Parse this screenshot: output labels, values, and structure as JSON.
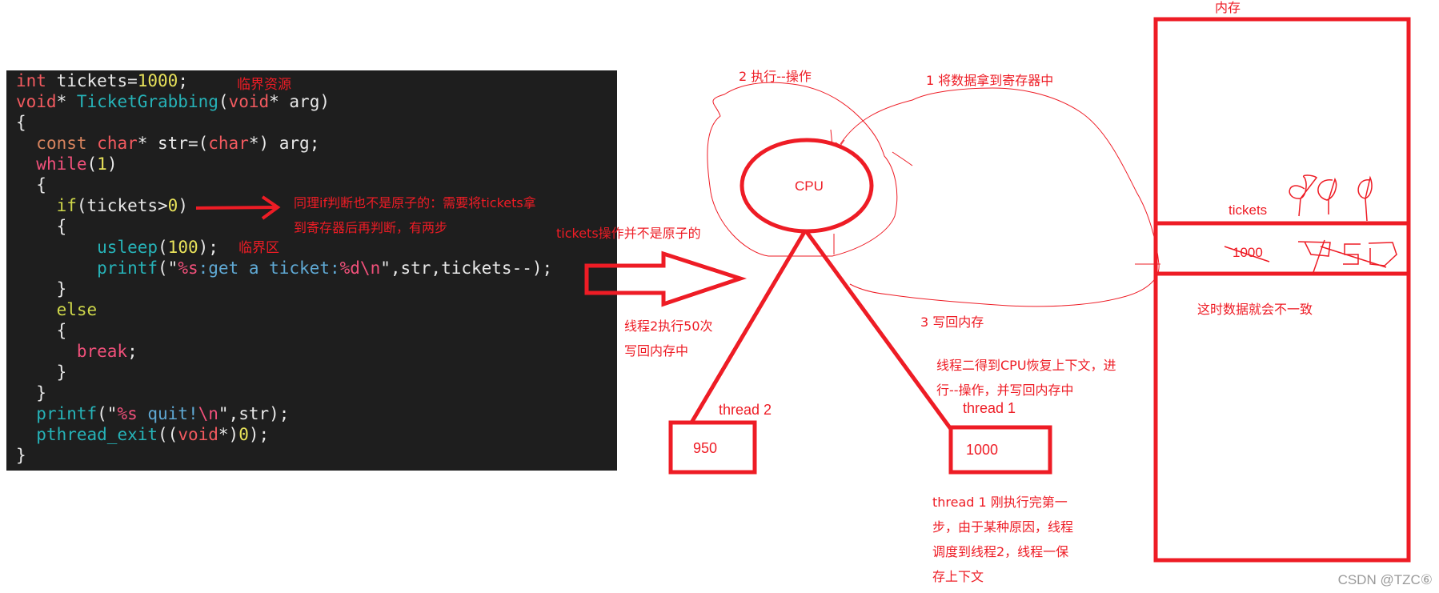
{
  "code": {
    "lines": [
      [
        {
          "t": "int",
          "c": "kw-type"
        },
        {
          "t": " tickets="
        },
        {
          "t": "1000",
          "c": "num"
        },
        {
          "t": ";"
        }
      ],
      [
        {
          "t": "void",
          "c": "kw-type"
        },
        {
          "t": "* "
        },
        {
          "t": "TicketGrabbing",
          "c": "fn"
        },
        {
          "t": "("
        },
        {
          "t": "void",
          "c": "kw-type"
        },
        {
          "t": "* arg)"
        }
      ],
      [
        {
          "t": "{"
        }
      ],
      [
        {
          "t": "  "
        },
        {
          "t": "const",
          "c": "kw-const"
        },
        {
          "t": " "
        },
        {
          "t": "char",
          "c": "kw-type"
        },
        {
          "t": "* str=("
        },
        {
          "t": "char",
          "c": "kw-type"
        },
        {
          "t": "*) arg;"
        }
      ],
      [
        {
          "t": "  "
        },
        {
          "t": "while",
          "c": "kw-ctrl"
        },
        {
          "t": "("
        },
        {
          "t": "1",
          "c": "num"
        },
        {
          "t": ")"
        }
      ],
      [
        {
          "t": "  {"
        }
      ],
      [
        {
          "t": "    "
        },
        {
          "t": "if",
          "c": "kw-if"
        },
        {
          "t": "(tickets>"
        },
        {
          "t": "0",
          "c": "num"
        },
        {
          "t": ")"
        }
      ],
      [
        {
          "t": "    {"
        }
      ],
      [
        {
          "t": "        "
        },
        {
          "t": "usleep",
          "c": "fn"
        },
        {
          "t": "("
        },
        {
          "t": "100",
          "c": "num"
        },
        {
          "t": ");"
        }
      ],
      [
        {
          "t": "        "
        },
        {
          "t": "printf",
          "c": "fn"
        },
        {
          "t": "(\""
        },
        {
          "t": "%s",
          "c": "fmt"
        },
        {
          "t": ":get a ticket:",
          "c": "str"
        },
        {
          "t": "%d",
          "c": "fmt"
        },
        {
          "t": "\\n",
          "c": "esc"
        },
        {
          "t": "\",str,tickets--);"
        }
      ],
      [
        {
          "t": "    }"
        }
      ],
      [
        {
          "t": "    "
        },
        {
          "t": "else",
          "c": "kw-if"
        }
      ],
      [
        {
          "t": "    {"
        }
      ],
      [
        {
          "t": "      "
        },
        {
          "t": "break",
          "c": "kw-ctrl"
        },
        {
          "t": ";"
        }
      ],
      [
        {
          "t": "    }"
        }
      ],
      [
        {
          "t": "  }"
        }
      ],
      [
        {
          "t": "  "
        },
        {
          "t": "printf",
          "c": "fn"
        },
        {
          "t": "(\""
        },
        {
          "t": "%s",
          "c": "fmt"
        },
        {
          "t": " quit!",
          "c": "str"
        },
        {
          "t": "\\n",
          "c": "esc"
        },
        {
          "t": "\",str);"
        }
      ],
      [
        {
          "t": "  "
        },
        {
          "t": "pthread_exit",
          "c": "fn"
        },
        {
          "t": "(("
        },
        {
          "t": "void",
          "c": "kw-type"
        },
        {
          "t": "*)"
        },
        {
          "t": "0",
          "c": "num"
        },
        {
          "t": ");"
        }
      ],
      [
        {
          "t": "}"
        }
      ]
    ]
  },
  "annotations": {
    "critical_resource": "临界资源",
    "critical_section": "临界区",
    "if_not_atomic": "同理if判断也不是原子的：需要将tickets拿\n到寄存器后再判断，有两步",
    "tickets_not_atomic": "tickets操作并不是原子的",
    "step2": "2 执行--操作",
    "step1": "1 将数据拿到寄存器中",
    "step3": "3 写回内存",
    "thread2_exec": "线程2执行50次\n写回内存中",
    "thread2_resume": "线程二得到CPU恢复上下文，进\n行--操作，并写回内存中",
    "thread1_explain": "thread 1 刚执行完第一\n步，由于某种原因，线程\n调度到线程2，线程一保\n存上下文",
    "inconsistent": "这时数据就会不一致"
  },
  "cpu": {
    "label": "CPU"
  },
  "threads": [
    {
      "name": "thread 2",
      "value": "950"
    },
    {
      "name": "thread 1",
      "value": "1000"
    }
  ],
  "memory": {
    "label": "内存",
    "var_name": "tickets",
    "old_value": "1000",
    "handwritten_top": "999",
    "handwritten_new": "950"
  },
  "colors": {
    "annotation_red": "#ee1c25",
    "code_bg": "#1e1e1e"
  },
  "watermark": "CSDN @TZC⑥"
}
